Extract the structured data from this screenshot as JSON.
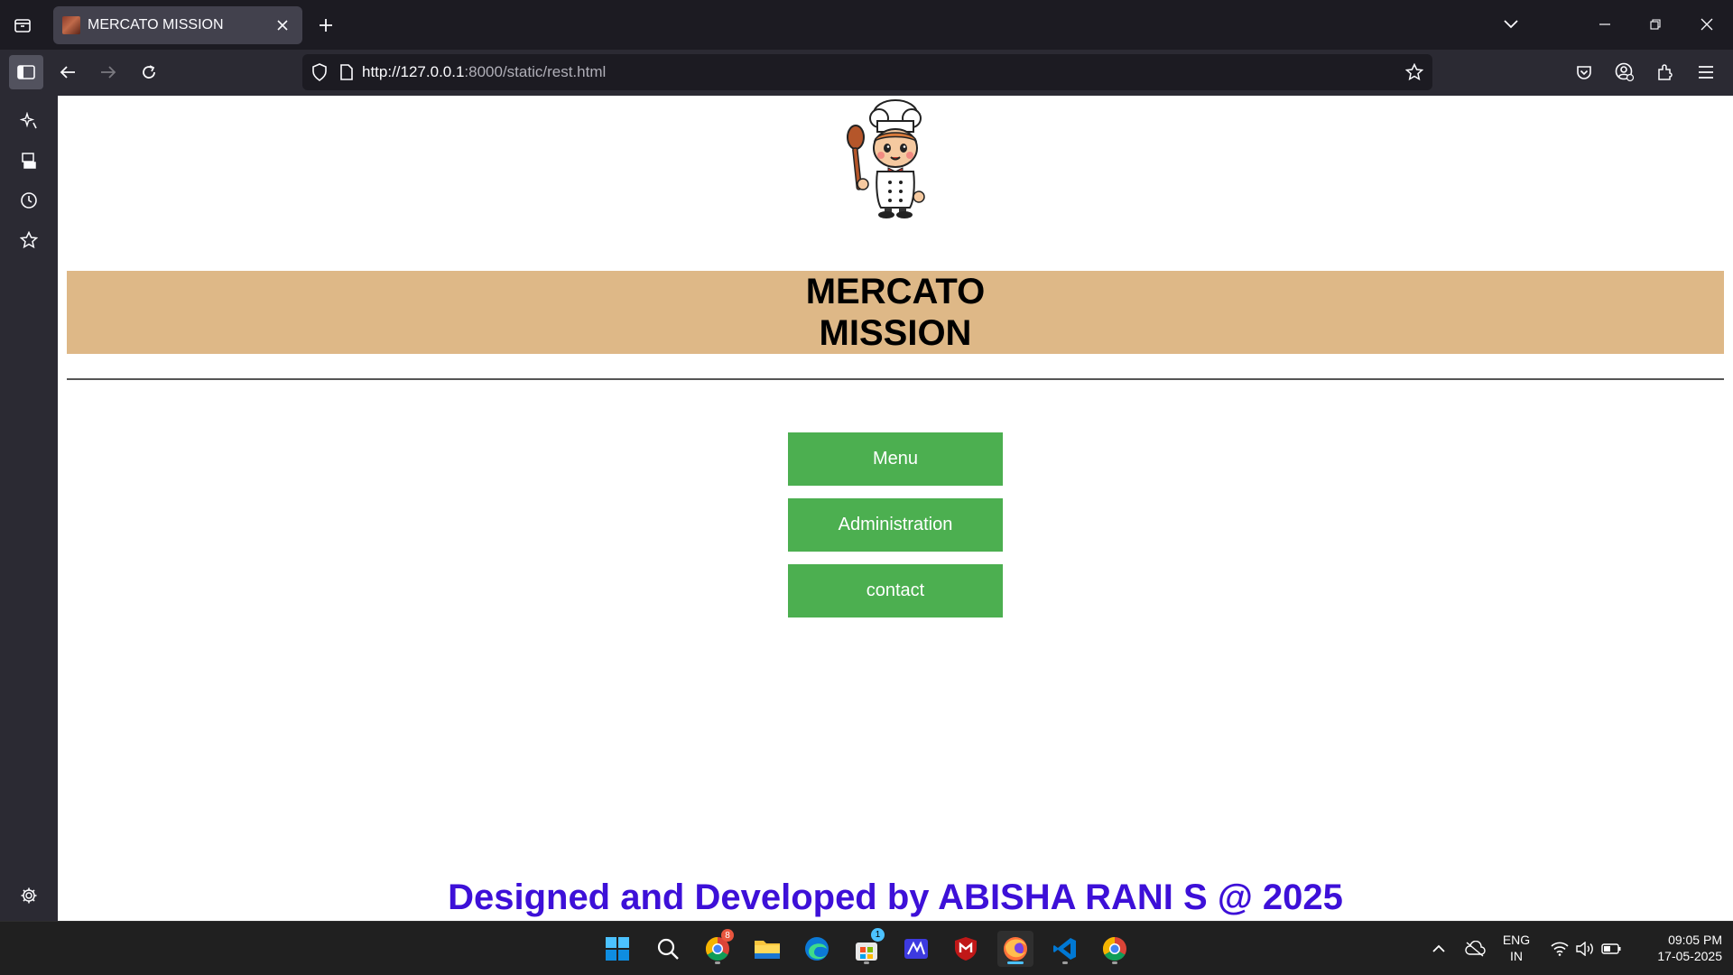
{
  "browser": {
    "tab_title": "MERCATO MISSION",
    "url_host": "http://127.0.0.1",
    "url_rest": ":8000/static/rest.html"
  },
  "page": {
    "title_line1": "MERCATO",
    "title_line2": "MISSION",
    "buttons": [
      "Menu",
      "Administration",
      "contact"
    ],
    "footer": "Designed and Developed by ABISHA RANI S @ 2025",
    "colors": {
      "banner": "#deb887",
      "button": "#4caf50",
      "footer_text": "#3d10d8"
    }
  },
  "taskbar": {
    "lang_line1": "ENG",
    "lang_line2": "IN",
    "time": "09:05 PM",
    "date": "17-05-2025",
    "chrome_badge": "8",
    "store_badge": "1"
  }
}
